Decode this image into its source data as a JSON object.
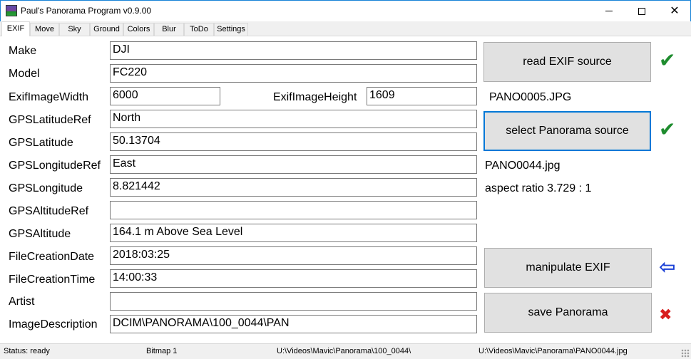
{
  "window": {
    "title": "Paul's Panorama Program v0.9.00",
    "minimize_label": "—",
    "close_label": "✕"
  },
  "tabs": [
    {
      "label": "EXIF"
    },
    {
      "label": "Move"
    },
    {
      "label": "Sky"
    },
    {
      "label": "Ground"
    },
    {
      "label": "Colors"
    },
    {
      "label": "Blur"
    },
    {
      "label": "ToDo"
    },
    {
      "label": "Settings"
    }
  ],
  "active_tab": "EXIF",
  "exif": {
    "make": {
      "label": "Make",
      "value": "DJI"
    },
    "model": {
      "label": "Model",
      "value": "FC220"
    },
    "width": {
      "label": "ExifImageWidth",
      "value": "6000"
    },
    "height": {
      "label": "ExifImageHeight",
      "value": "1609"
    },
    "lat_ref": {
      "label": "GPSLatitudeRef",
      "value": "North"
    },
    "lat": {
      "label": "GPSLatitude",
      "value": "50.13704"
    },
    "lon_ref": {
      "label": "GPSLongitudeRef",
      "value": "East"
    },
    "lon": {
      "label": "GPSLongitude",
      "value": "8.821442"
    },
    "alt_ref": {
      "label": "GPSAltitudeRef",
      "value": ""
    },
    "alt": {
      "label": "GPSAltitude",
      "value": "164.1 m Above Sea Level"
    },
    "date": {
      "label": "FileCreationDate",
      "value": "2018:03:25"
    },
    "time": {
      "label": "FileCreationTime",
      "value": "14:00:33"
    },
    "artist": {
      "label": "Artist",
      "value": ""
    },
    "description": {
      "label": "ImageDescription",
      "value": "DCIM\\PANORAMA\\100_0044\\PAN"
    }
  },
  "actions": {
    "read_exif": "read EXIF source",
    "exif_file": "PANO0005.JPG",
    "select_panorama": "select Panorama source",
    "panorama_file": "PANO0044.jpg",
    "aspect_ratio": "aspect ratio 3.729 : 1",
    "manipulate_exif": "manipulate EXIF",
    "save_panorama": "save Panorama"
  },
  "indicators": {
    "read_exif": {
      "icon": "check-icon",
      "glyph": "✔",
      "color": "#1e8c2e"
    },
    "select_panorama": {
      "icon": "check-icon",
      "glyph": "✔",
      "color": "#1e8c2e"
    },
    "manipulate_exif": {
      "icon": "arrow-left-icon",
      "glyph": "⇦",
      "color": "#1a3fd6"
    },
    "save_panorama": {
      "icon": "cross-icon",
      "glyph": "✖",
      "color": "#d81c1c"
    }
  },
  "status": {
    "state": "Status: ready",
    "bitmap": "Bitmap 1",
    "exif_path": "U:\\Videos\\Mavic\\Panorama\\100_0044\\",
    "panorama_path": "U:\\Videos\\Mavic\\Panorama\\PANO0044.jpg"
  }
}
